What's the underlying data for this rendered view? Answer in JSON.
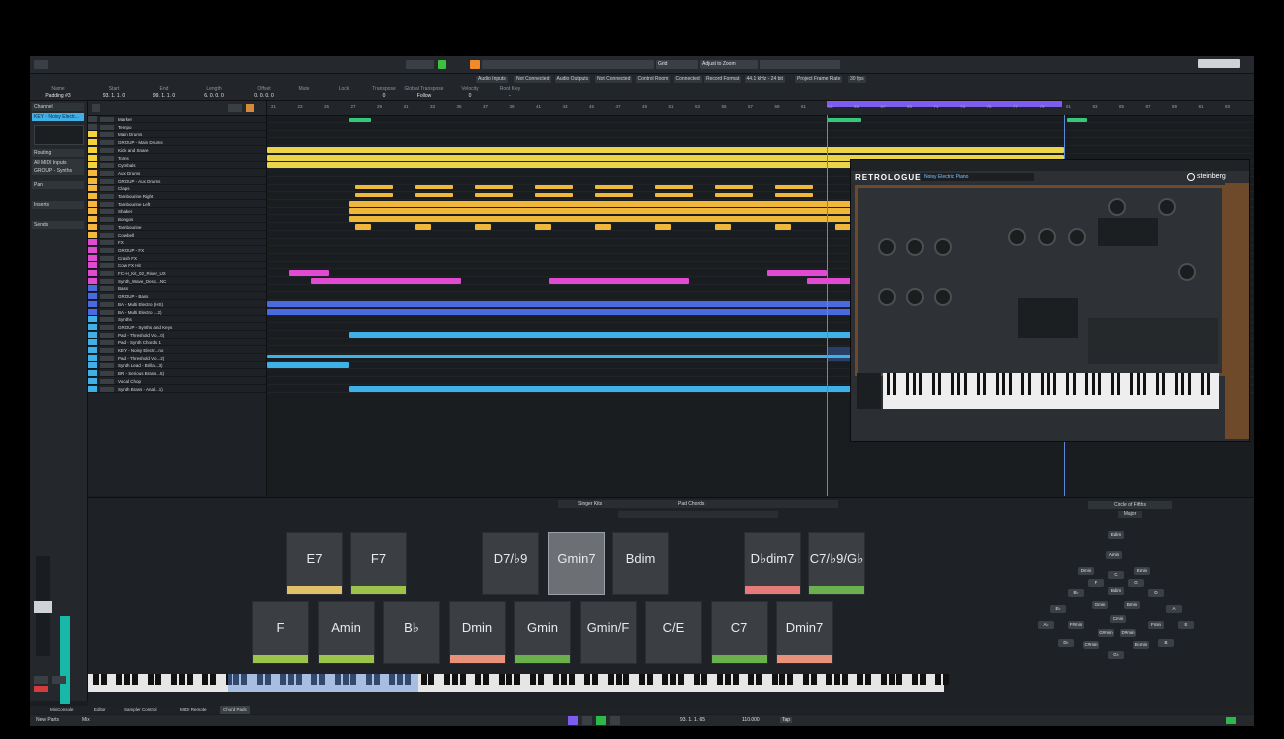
{
  "infoline": {
    "cells": [
      {
        "label": "Name",
        "value": "Padding #3"
      },
      {
        "label": "Start",
        "value": "93. 1. 1. 0"
      },
      {
        "label": "End",
        "value": "99. 1. 1. 0"
      },
      {
        "label": "Length",
        "value": "6. 0. 0. 0"
      },
      {
        "label": "Offset",
        "value": "0. 0. 0. 0"
      },
      {
        "label": "Mute",
        "value": ""
      },
      {
        "label": "Lock",
        "value": ""
      },
      {
        "label": "Transpose",
        "value": "0"
      },
      {
        "label": "Global Transpose",
        "value": "Follow"
      },
      {
        "label": "Velocity",
        "value": "0"
      },
      {
        "label": "Root Key",
        "value": "-"
      }
    ]
  },
  "toolbar": {
    "snap": "Grid",
    "quantize": "Adjust to Zoom",
    "sub_buttons": [
      "Audio Inputs",
      "Not Connected",
      "Audio Outputs",
      "Not Connected",
      "Control Room",
      "Connected",
      "Record Format",
      "44.1 kHz - 24 bit",
      "Project Frame Rate",
      "30 fps"
    ]
  },
  "inspector": {
    "tab": "Channel",
    "track_name": "KEY - Noisy Electr...",
    "rows": [
      "Routing",
      "All MIDI Inputs",
      "GROUP - Synths",
      "Pan",
      "Inserts",
      "Sends"
    ]
  },
  "tracks": [
    {
      "name": "Marker",
      "color": "#3a3f44"
    },
    {
      "name": "Tempo",
      "color": "#3a3f44"
    },
    {
      "name": "Main Drums",
      "color": "#f3d23a"
    },
    {
      "name": "GROUP - Main Drums",
      "color": "#f3d23a"
    },
    {
      "name": "Kick and Snare",
      "color": "#f3d23a"
    },
    {
      "name": "Toms",
      "color": "#f3d23a"
    },
    {
      "name": "Cymbals",
      "color": "#f3d23a"
    },
    {
      "name": "Aux Drums",
      "color": "#f5b83a"
    },
    {
      "name": "GROUP - Aux Drums",
      "color": "#f5b83a"
    },
    {
      "name": "Claps",
      "color": "#f5b83a"
    },
    {
      "name": "Tambourine Right",
      "color": "#f5b83a"
    },
    {
      "name": "Tambourine Left",
      "color": "#f5b83a"
    },
    {
      "name": "Shaker",
      "color": "#f5b83a"
    },
    {
      "name": "Bongos",
      "color": "#f5b83a"
    },
    {
      "name": "Tambourine",
      "color": "#f5b83a"
    },
    {
      "name": "Cowbell",
      "color": "#f5b83a"
    },
    {
      "name": "FX",
      "color": "#e04bd1"
    },
    {
      "name": "GROUP - FX",
      "color": "#e04bd1"
    },
    {
      "name": "Crash FX",
      "color": "#e04bd1"
    },
    {
      "name": "Cow FX Hit",
      "color": "#e04bd1"
    },
    {
      "name": "FC-H_Kit_02_Riser_UX",
      "color": "#e04bd1"
    },
    {
      "name": "Synth_Wave_Desc...NC",
      "color": "#e04bd1"
    },
    {
      "name": "Bass",
      "color": "#4a6be0"
    },
    {
      "name": "GROUP - Bass",
      "color": "#4a6be0"
    },
    {
      "name": "BA - Multi Electro (HS)",
      "color": "#4a6be0"
    },
    {
      "name": "BA - Multi Electro ...2)",
      "color": "#4a6be0"
    },
    {
      "name": "Synths",
      "color": "#3fb0e8"
    },
    {
      "name": "GROUP - Synths and Keys",
      "color": "#3fb0e8"
    },
    {
      "name": "Pad - Threshold Vo...0)",
      "color": "#3fb0e8"
    },
    {
      "name": "Pad - Synth Chords 1",
      "color": "#3fb0e8"
    },
    {
      "name": "KEY - Noisy Electr...no",
      "color": "#3fb0e8"
    },
    {
      "name": "Pad - Threshold Vo...2)",
      "color": "#3fb0e8"
    },
    {
      "name": "Synth Lead - Brilla...3)",
      "color": "#3fb0e8"
    },
    {
      "name": "BR - Serious Brass...5)",
      "color": "#3fb0e8"
    },
    {
      "name": "Vocal Chop",
      "color": "#3fb0e8"
    },
    {
      "name": "Synth Brass - Anal...1)",
      "color": "#3fb0e8"
    }
  ],
  "ruler": [
    "21",
    "23",
    "25",
    "27",
    "29",
    "31",
    "33",
    "35",
    "37",
    "39",
    "41",
    "43",
    "45",
    "47",
    "49",
    "51",
    "53",
    "55",
    "57",
    "59",
    "61",
    "63",
    "65",
    "67",
    "69",
    "71",
    "73",
    "75",
    "77",
    "79",
    "81",
    "83",
    "85",
    "87",
    "89",
    "91",
    "93"
  ],
  "plugin": {
    "title": "RETROLOGUE 2",
    "preset": "Noisy Electric Piano",
    "brand": "steinberg"
  },
  "chord_pads": {
    "toolbar_label": "Singer Kits",
    "player": "Pad Chords",
    "circle_title": "Circle of Fifths",
    "circle_mode": "Major",
    "top_row": [
      {
        "label": "E7",
        "color": "#e0c068"
      },
      {
        "label": "F7",
        "color": "#9cc44a"
      },
      {
        "label": "D7/♭9",
        "color": ""
      },
      {
        "label": "Gmin7",
        "color": "",
        "selected": true
      },
      {
        "label": "Bdim",
        "color": ""
      },
      {
        "label": "D♭dim7",
        "color": "#e77b7b"
      },
      {
        "label": "C7/♭9/G♭",
        "color": "#6ab04c"
      }
    ],
    "bottom_row": [
      {
        "label": "F",
        "color": "#9cc44a"
      },
      {
        "label": "Amin",
        "color": "#9cc44a"
      },
      {
        "label": "B♭",
        "color": ""
      },
      {
        "label": "Dmin",
        "color": "#e8927c"
      },
      {
        "label": "Gmin",
        "color": "#6ab04c"
      },
      {
        "label": "Gmin/F",
        "color": ""
      },
      {
        "label": "C/E",
        "color": ""
      },
      {
        "label": "C7",
        "color": "#6ab04c"
      },
      {
        "label": "Dmin7",
        "color": "#e8927c"
      }
    ],
    "circle_nodes": [
      "C",
      "F",
      "G",
      "B♭",
      "D",
      "E♭",
      "A",
      "A♭",
      "E",
      "D♭",
      "B",
      "G♭",
      "Amin",
      "Dmin",
      "Emin",
      "Gmin",
      "Bmin",
      "Cmin",
      "F#min",
      "Fmin",
      "C#min",
      "B♭min",
      "G#min",
      "D#min",
      "Bdim",
      "Edim"
    ]
  },
  "bottom_tabs": [
    "MixConsole",
    "Editor",
    "Sampler Control",
    "MIDI Remote",
    "Chord Pads"
  ],
  "transport": {
    "position": "93. 1. 1. 65",
    "tempo": "110.000",
    "signature": "Tap"
  },
  "status": {
    "parts": "New Parts",
    "mix": "Mix"
  }
}
